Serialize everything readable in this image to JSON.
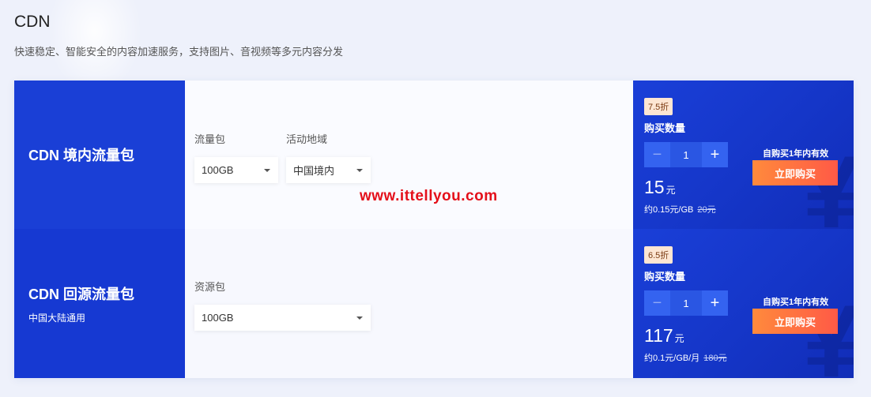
{
  "header": {
    "title": "CDN",
    "subtitle": "快速稳定、智能安全的内容加速服务，支持图片、音视频等多元内容分发"
  },
  "watermark": "www.ittellyou.com",
  "products": [
    {
      "name": "CDN 境内流量包",
      "sub": "",
      "fields": [
        {
          "label": "流量包",
          "value": "100GB"
        },
        {
          "label": "活动地域",
          "value": "中国境内"
        }
      ],
      "discount": "7.5折",
      "qty_label": "购买数量",
      "qty": "1",
      "minus": "−",
      "plus": "+",
      "price": "15",
      "price_unit": "元",
      "unit_price": "约0.15元/GB",
      "orig_price": "20元",
      "validity": "自购买1年内有效",
      "buy_label": "立即购买"
    },
    {
      "name": "CDN 回源流量包",
      "sub": "中国大陆通用",
      "fields": [
        {
          "label": "资源包",
          "value": "100GB"
        }
      ],
      "discount": "6.5折",
      "qty_label": "购买数量",
      "qty": "1",
      "minus": "−",
      "plus": "+",
      "price": "117",
      "price_unit": "元",
      "unit_price": "约0.1元/GB/月",
      "orig_price": "180元",
      "validity": "自购买1年内有效",
      "buy_label": "立即购买"
    }
  ],
  "icons": {
    "dropdown": "chevron-down-icon",
    "decoration": "yen-icon"
  },
  "decor_glyph": "¥",
  "colors": {
    "brand_blue": "#1a3fd6",
    "buy_orange": "#ff6a40",
    "watermark_red": "#e4101a"
  }
}
